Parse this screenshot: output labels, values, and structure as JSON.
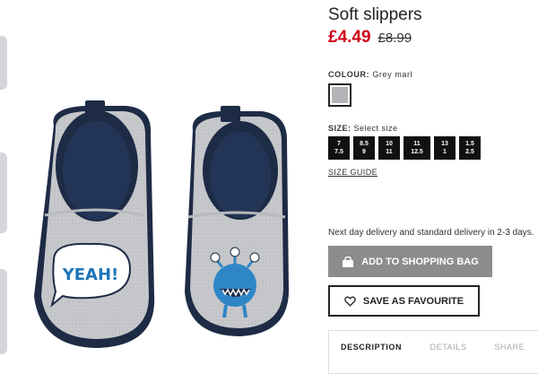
{
  "product": {
    "title": "Soft slippers",
    "price_now": "£4.49",
    "price_was": "£8.99"
  },
  "colour": {
    "label": "COLOUR:",
    "value": "Grey marl",
    "swatch_color": "#b3b4b8"
  },
  "size": {
    "label": "SIZE:",
    "prompt": "Select size",
    "options": [
      {
        "top": "7",
        "bottom": "7.5"
      },
      {
        "top": "8.5",
        "bottom": "9"
      },
      {
        "top": "10",
        "bottom": "11"
      },
      {
        "top": "11",
        "bottom": "12.5"
      },
      {
        "top": "13",
        "bottom": "1"
      },
      {
        "top": "1.5",
        "bottom": "2.5"
      }
    ],
    "guide_link": "SIZE GUIDE"
  },
  "delivery_text": "Next day delivery and standard delivery in 2-3 days.",
  "actions": {
    "add_to_bag": "ADD TO SHOPPING BAG",
    "save_favourite": "SAVE AS FAVOURITE"
  },
  "tabs": [
    "DESCRIPTION",
    "DETAILS",
    "SHARE"
  ],
  "image": {
    "speech_bubble_text": "YEAH!"
  },
  "colors": {
    "price_red": "#d0021b",
    "bag_button": "#8c8c8c",
    "slipper_grey": "#c9cacd",
    "navy": "#1d2b45",
    "monster_blue": "#2f86c6"
  }
}
